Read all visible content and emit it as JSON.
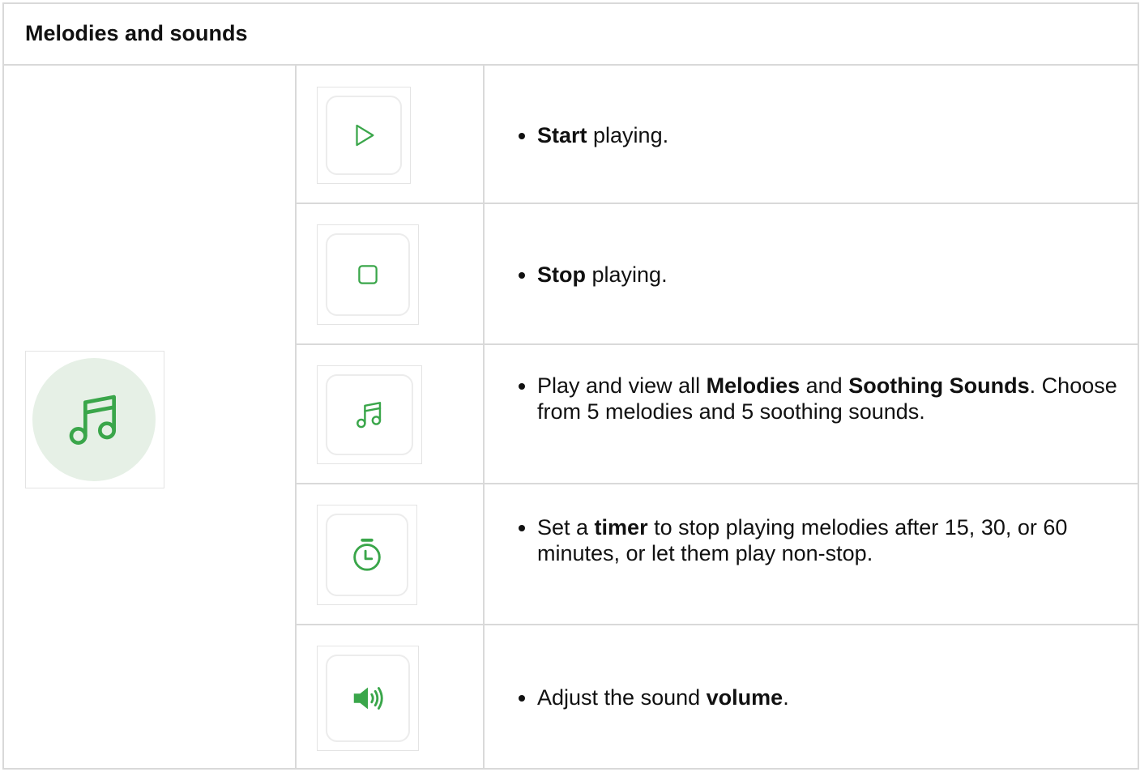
{
  "header": {
    "title": "Melodies and sounds"
  },
  "main_icon": {
    "name": "music-note-icon",
    "color": "#3aa64a",
    "background": "#e6f0e6"
  },
  "rows": [
    {
      "icon": "play-icon",
      "parts": [
        {
          "text": " ",
          "bold": false
        },
        {
          "text": "Start",
          "bold": true
        },
        {
          "text": " playing.",
          "bold": false
        }
      ]
    },
    {
      "icon": "stop-icon",
      "parts": [
        {
          "text": "Stop",
          "bold": true
        },
        {
          "text": " playing.",
          "bold": false
        }
      ]
    },
    {
      "icon": "music-note-icon",
      "parts": [
        {
          "text": "Play and view all ",
          "bold": false
        },
        {
          "text": "Melodies",
          "bold": true
        },
        {
          "text": " and ",
          "bold": false
        },
        {
          "text": "Soothing Sounds",
          "bold": true
        },
        {
          "text": ". Choose from 5 melodies and 5 soothing sounds.",
          "bold": false
        }
      ]
    },
    {
      "icon": "timer-icon",
      "parts": [
        {
          "text": "Set a ",
          "bold": false
        },
        {
          "text": "timer",
          "bold": true
        },
        {
          "text": " to stop playing melodies after 15, 30, or 60 minutes, or let them play non-stop.",
          "bold": false
        }
      ]
    },
    {
      "icon": "volume-icon",
      "parts": [
        {
          "text": "Adjust the sound ",
          "bold": false
        },
        {
          "text": "volume",
          "bold": true
        },
        {
          "text": ".",
          "bold": false
        }
      ]
    }
  ],
  "colors": {
    "accent": "#3aa64a",
    "border": "#d9d9d9",
    "text": "#111111"
  }
}
